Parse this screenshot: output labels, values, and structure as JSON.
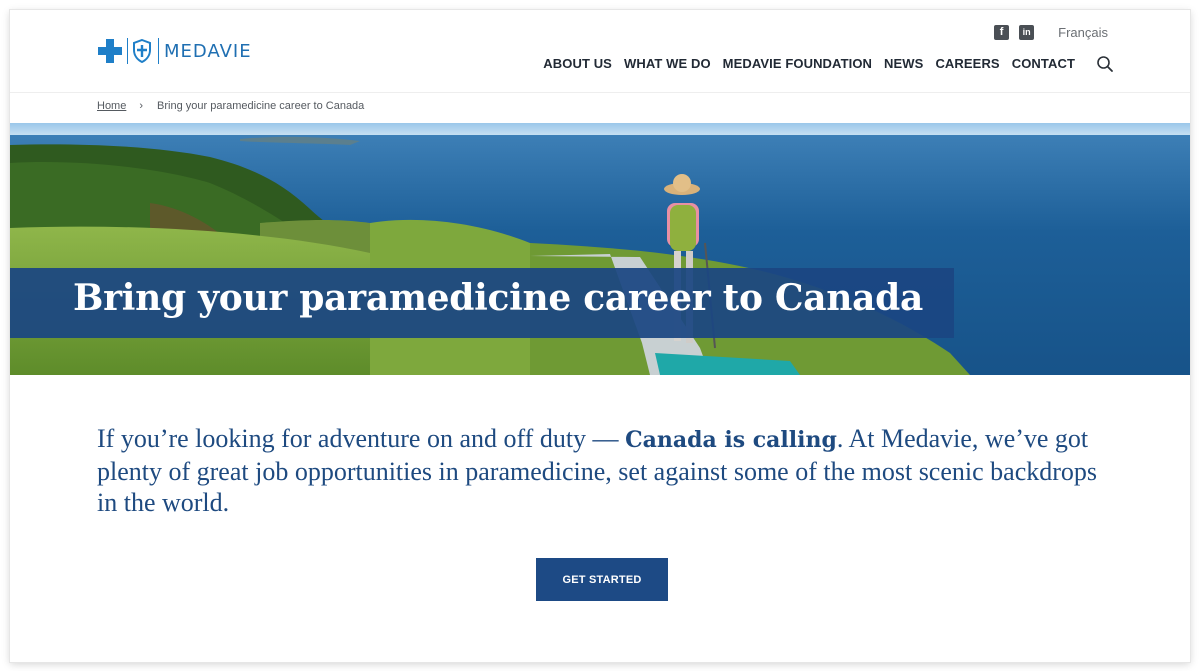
{
  "brand": {
    "name": "MEDAVIE",
    "primary_color": "#1d4a85",
    "accent_color": "#1f7fc8"
  },
  "utility": {
    "social": [
      {
        "icon": "facebook-icon",
        "glyph": "f"
      },
      {
        "icon": "linkedin-icon",
        "glyph": "in"
      }
    ],
    "language_link": "Français"
  },
  "nav": {
    "items": [
      {
        "label": "ABOUT US"
      },
      {
        "label": "WHAT WE DO"
      },
      {
        "label": "MEDAVIE FOUNDATION"
      },
      {
        "label": "NEWS"
      },
      {
        "label": "CAREERS"
      },
      {
        "label": "CONTACT"
      }
    ],
    "search_icon": "search-icon"
  },
  "breadcrumb": {
    "home": "Home",
    "separator": "›",
    "current": "Bring your paramedicine career to Canada"
  },
  "hero": {
    "title": "Bring your paramedicine career to Canada"
  },
  "intro": {
    "text_before": "If you’re looking for adventure on and off duty — ",
    "emphasis": "Canada is calling",
    "text_after": ". At Medavie, we’ve got plenty of great job opportunities in paramedicine, set against some of the most scenic backdrops in the world."
  },
  "cta": {
    "label": "GET STARTED"
  }
}
